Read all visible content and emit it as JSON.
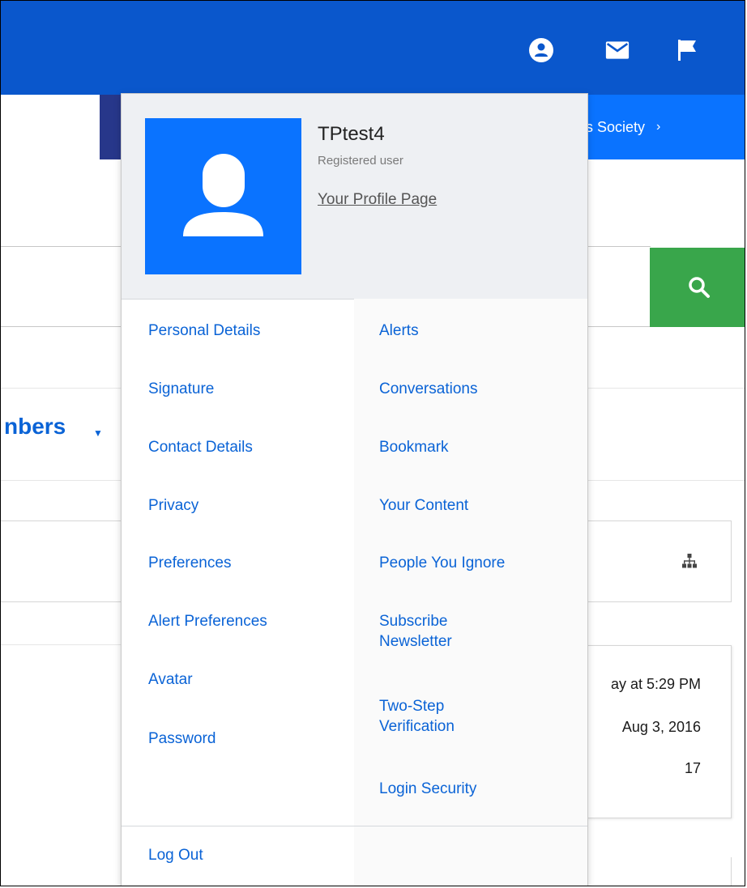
{
  "topbar": {
    "icons": [
      "account-icon",
      "inbox-icon",
      "alerts-flag-icon"
    ]
  },
  "background": {
    "banner_text": "s Society",
    "banner_chevron": "›",
    "members_label": "nbers",
    "members_caret": "▼",
    "card_lines": [
      "ay at 5:29 PM",
      "Aug 3, 2016",
      "17"
    ]
  },
  "popup": {
    "username": "TPtest4",
    "user_title": "Registered user",
    "profile_link": "Your Profile Page",
    "left_links": [
      "Personal Details",
      "Signature",
      "Contact Details",
      "Privacy",
      "Preferences",
      "Alert Preferences",
      "Avatar",
      "Password"
    ],
    "right_links": [
      "Alerts",
      "Conversations",
      "Bookmark",
      "Your Content",
      "People You Ignore",
      "Subscribe Newsletter",
      "Two-Step Verification",
      "Login Security"
    ],
    "logout": "Log Out"
  },
  "colors": {
    "topbar": "#0a57cc",
    "link": "#0a63d6",
    "avatar_bg": "#0a73ff",
    "search_button": "#39a64b",
    "header_bg": "#eef0f3"
  }
}
